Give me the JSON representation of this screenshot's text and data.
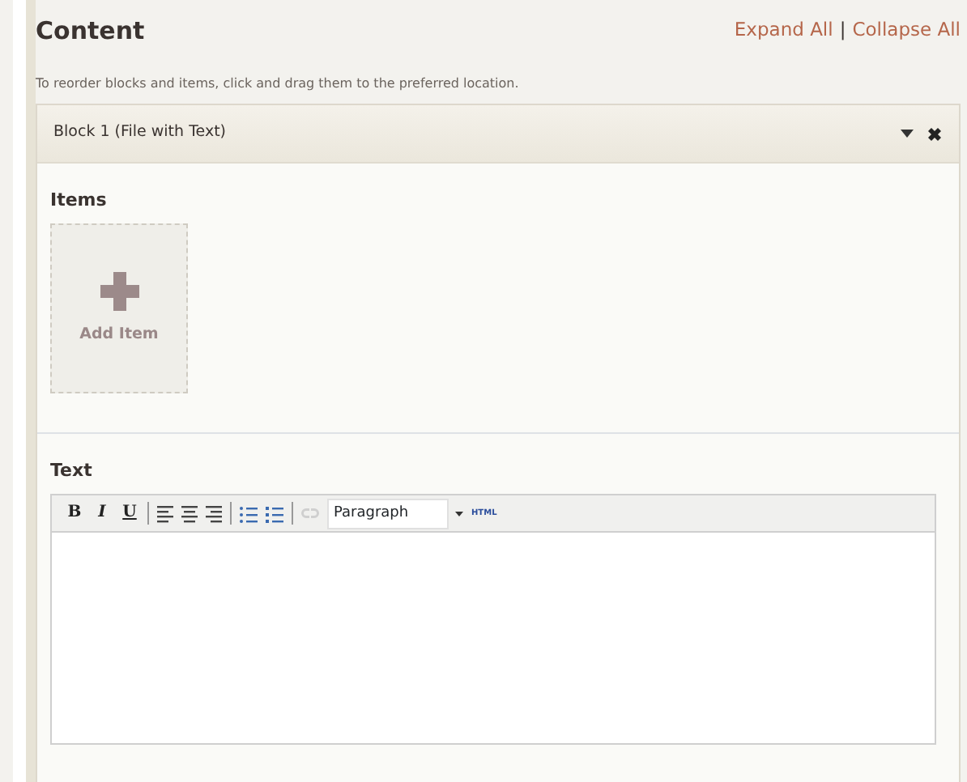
{
  "header": {
    "title": "Content",
    "links": [
      "Expand All",
      "Collapse All"
    ],
    "separator": "|"
  },
  "hint": "To reorder blocks and items, click and drag them to the preferred location.",
  "block": {
    "title": "Block 1 (File with Text)",
    "expanded": true,
    "items_section": {
      "heading": "Items",
      "add_label": "Add Item"
    },
    "text_section": {
      "heading": "Text",
      "toolbar": [
        {
          "kind": "bold",
          "label": "B"
        },
        {
          "kind": "italic",
          "label": "I"
        },
        {
          "kind": "underline",
          "label": "U"
        },
        {
          "kind": "separator"
        },
        {
          "kind": "align-left"
        },
        {
          "kind": "align-center"
        },
        {
          "kind": "align-right"
        },
        {
          "kind": "separator"
        },
        {
          "kind": "bullets"
        },
        {
          "kind": "numbers"
        },
        {
          "kind": "separator"
        },
        {
          "kind": "link",
          "disabled": true
        },
        {
          "kind": "select",
          "value": "Paragraph"
        },
        {
          "kind": "html",
          "label": "HTML"
        }
      ]
    }
  }
}
